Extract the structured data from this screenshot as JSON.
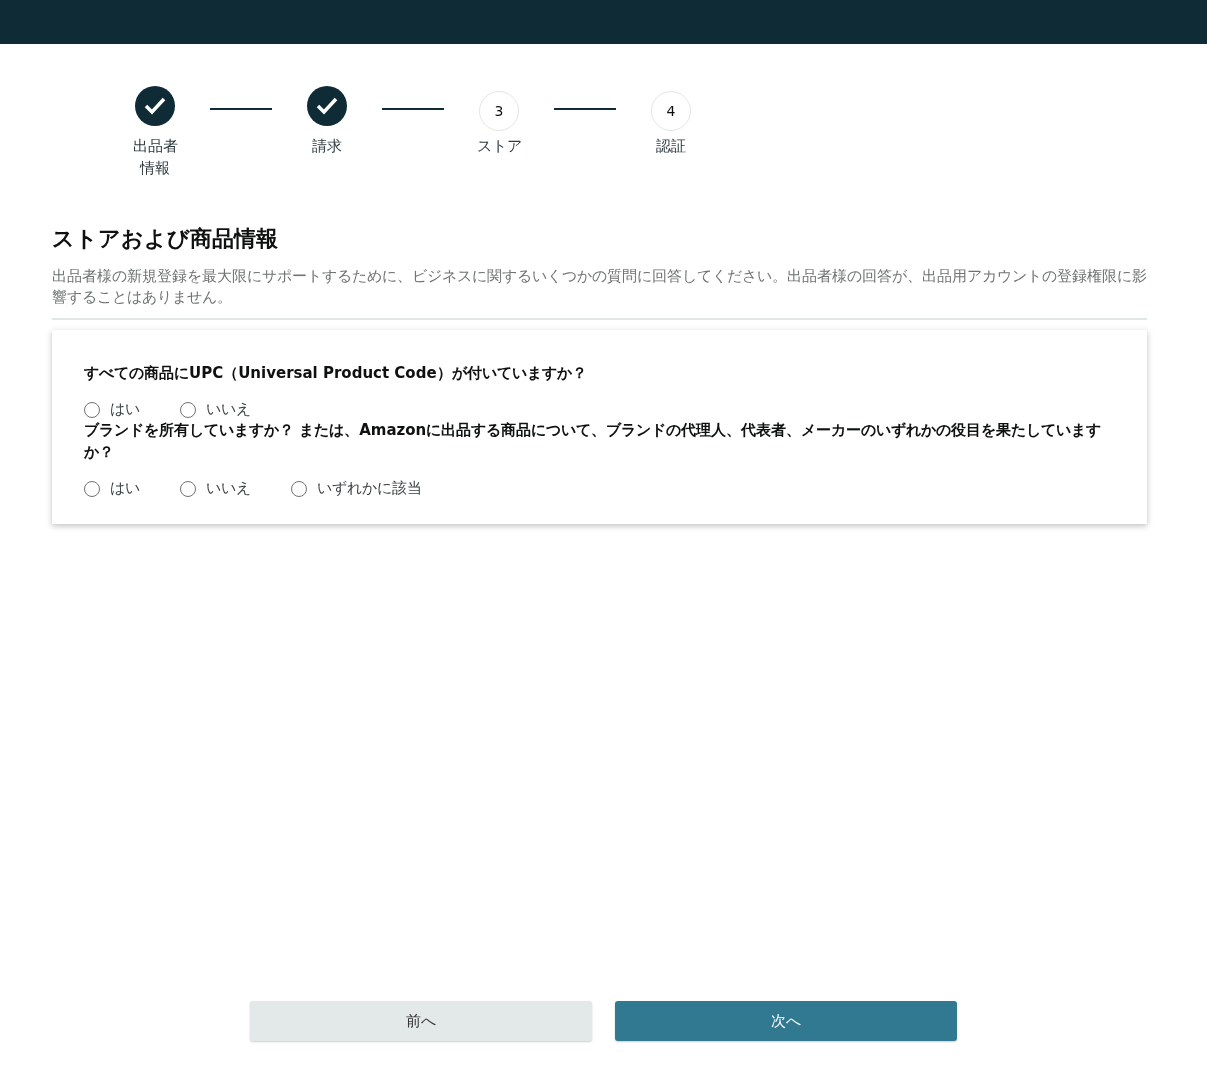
{
  "steps": [
    {
      "label": "出品者情報",
      "completed": true
    },
    {
      "label": "請求",
      "completed": true
    },
    {
      "label": "ストア",
      "completed": false,
      "number": "3"
    },
    {
      "label": "認証",
      "completed": false,
      "number": "4"
    }
  ],
  "heading": "ストアおよび商品情報",
  "description": "出品者様の新規登録を最大限にサポートするために、ビジネスに関するいくつかの質問に回答してください。出品者様の回答が、出品用アカウントの登録権限に影響することはありません。",
  "questions": [
    {
      "text": "すべての商品にUPC（Universal Product Code）が付いていますか？",
      "options": [
        {
          "label": "はい",
          "selected": false
        },
        {
          "label": "いいえ",
          "selected": false
        }
      ]
    },
    {
      "text": "ブランドを所有していますか？ または、Amazonに出品する商品について、ブランドの代理人、代表者、メーカーのいずれかの役目を果たしていますか？",
      "options": [
        {
          "label": "はい",
          "selected": false
        },
        {
          "label": "いいえ",
          "selected": false
        },
        {
          "label": "いずれかに該当",
          "selected": false
        }
      ]
    }
  ],
  "buttons": [
    {
      "label": "前へ",
      "kind": "secondary"
    },
    {
      "label": "次へ",
      "kind": "primary"
    }
  ]
}
